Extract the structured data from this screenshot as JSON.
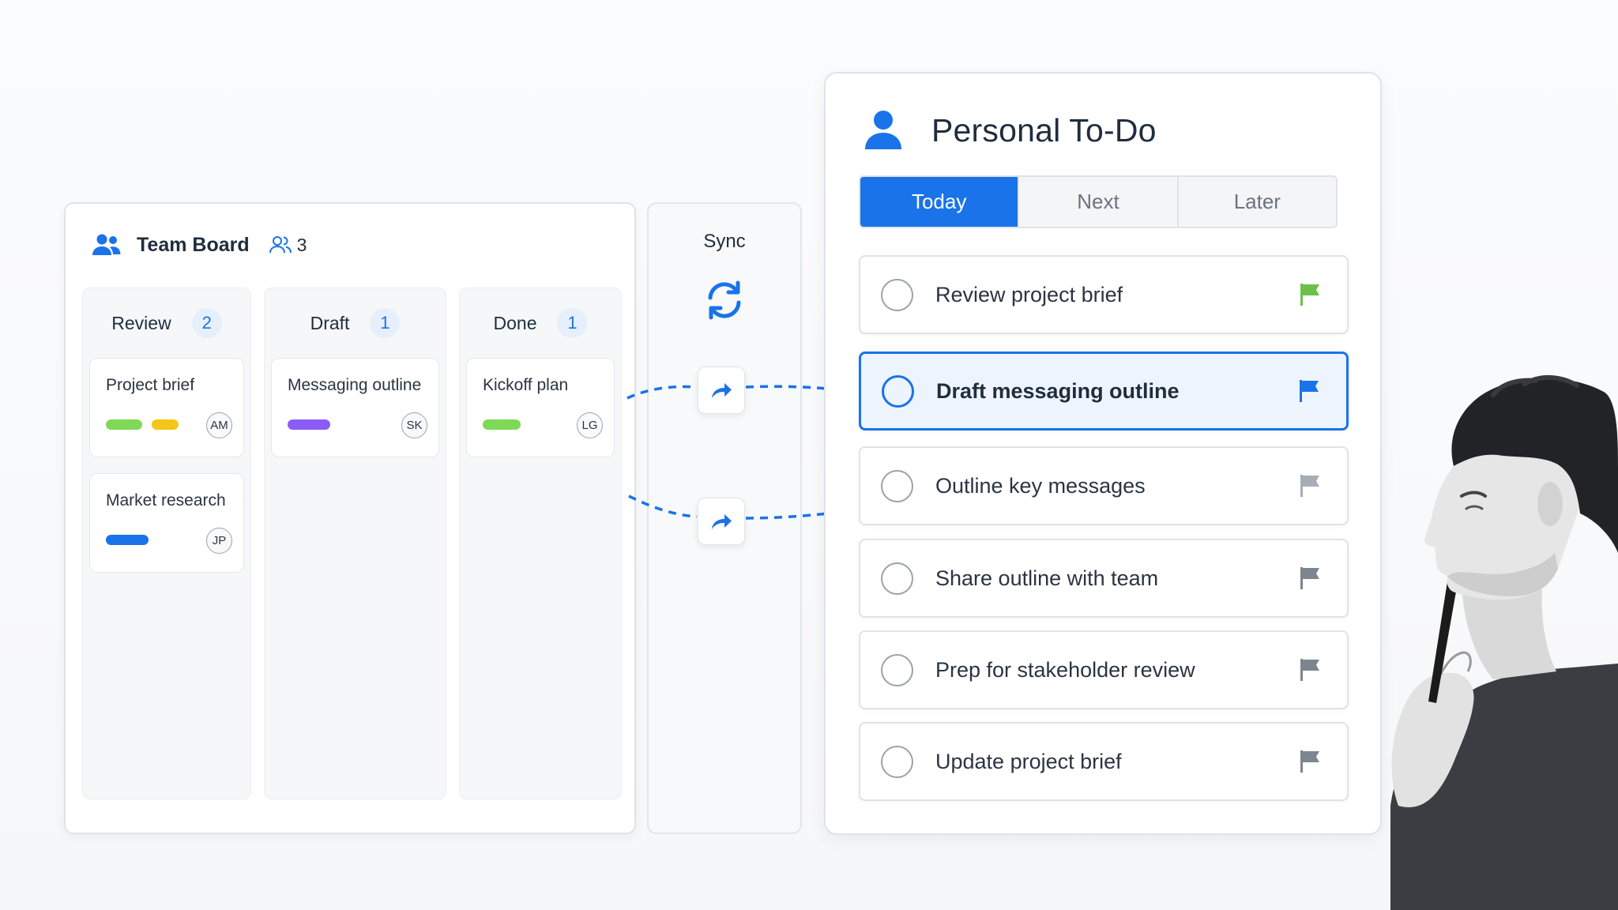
{
  "team_board": {
    "title": "Team Board",
    "member_count": "3",
    "columns": [
      {
        "title": "Review",
        "count": "2",
        "cards": [
          {
            "title": "Project brief",
            "avatar": "AM",
            "tags": [
              "#7ed957",
              "#f5c518"
            ]
          },
          {
            "title": "Market research",
            "avatar": "JP",
            "tags": [
              "#1a73e8"
            ]
          }
        ]
      },
      {
        "title": "Draft",
        "count": "1",
        "cards": [
          {
            "title": "Messaging outline",
            "avatar": "SK",
            "tags": [
              "#8b5cf6"
            ]
          }
        ]
      },
      {
        "title": "Done",
        "count": "1",
        "cards": [
          {
            "title": "Kickoff plan",
            "avatar": "LG",
            "tags": [
              "#7ed957"
            ]
          }
        ]
      }
    ]
  },
  "sync": {
    "label": "Sync",
    "icon": "sync-icon",
    "share_icon": "share-arrow-icon"
  },
  "todo": {
    "title": "Personal To-Do",
    "tabs": [
      {
        "label": "Today",
        "active": true
      },
      {
        "label": "Next",
        "active": false
      },
      {
        "label": "Later",
        "active": false
      }
    ],
    "tasks": [
      {
        "label": "Review project brief",
        "flag_color": "#6cc04a",
        "selected": false
      },
      {
        "label": "Draft messaging outline",
        "flag_color": "#1a73e8",
        "selected": true
      },
      {
        "label": "Outline key messages",
        "flag_color": "#a7adb5",
        "selected": false
      },
      {
        "label": "Share outline with team",
        "flag_color": "#7d858f",
        "selected": false
      },
      {
        "label": "Prep for stakeholder review",
        "flag_color": "#7d858f",
        "selected": false
      },
      {
        "label": "Update project brief",
        "flag_color": "#7d858f",
        "selected": false
      }
    ]
  },
  "colors": {
    "accent": "#1a73e8",
    "panel_border": "#dfe3e8",
    "text_primary": "#1f2d3d"
  }
}
